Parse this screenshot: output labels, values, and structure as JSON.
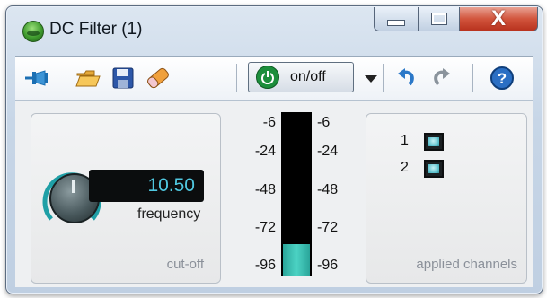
{
  "window": {
    "title": "DC Filter (1)",
    "close_glyph": "X",
    "icon": "app-globe-icon"
  },
  "toolbar": {
    "icons": [
      "pin-icon",
      "open-folder-icon",
      "save-disk-icon",
      "reset-eraser-icon",
      "power-icon",
      "chevron-down-icon",
      "undo-icon",
      "redo-icon",
      "help-icon"
    ],
    "onoff_label": "on/off"
  },
  "cutoff": {
    "frequency_value": "10.50",
    "frequency_label": "frequency",
    "section_label": "cut-off",
    "knob_level": 0.1
  },
  "meter": {
    "scale": [
      "-6",
      "-24",
      "-48",
      "-72",
      "-96"
    ],
    "level_db": -84
  },
  "channels": {
    "items": [
      {
        "number": "1"
      },
      {
        "number": "2"
      }
    ],
    "section_label": "applied channels"
  },
  "colors": {
    "accent": "#4cd3c4",
    "lcd_text": "#50c8e0",
    "power_green": "#1c8e3c",
    "close_red": "#c9432b"
  }
}
